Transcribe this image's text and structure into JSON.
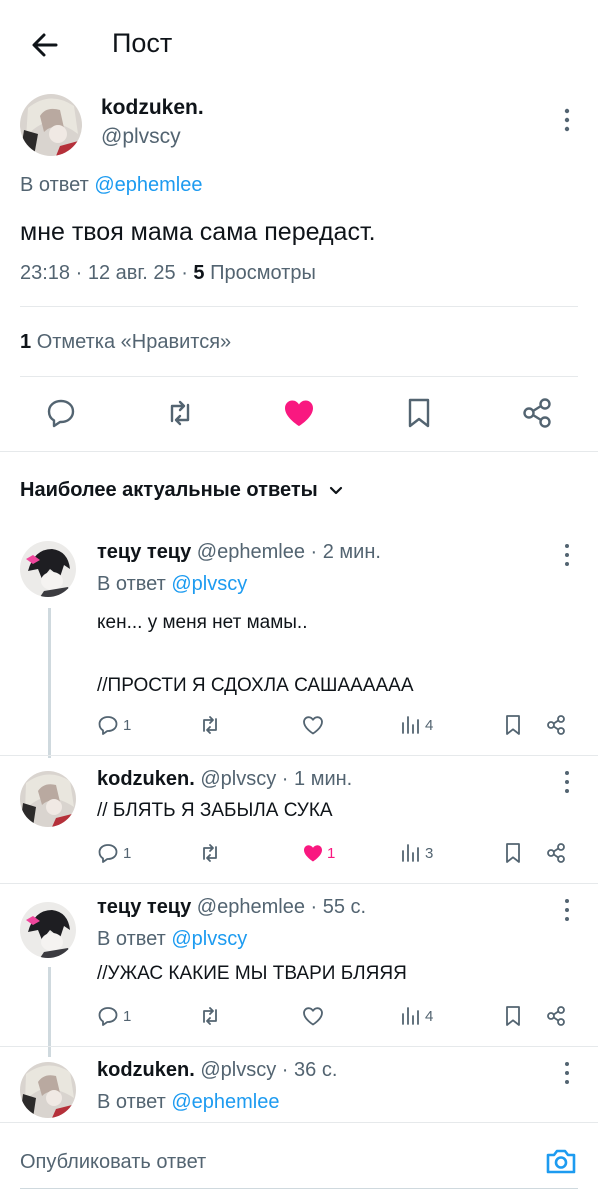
{
  "header": {
    "title": "Пост"
  },
  "main_post": {
    "display_name": "kodzuken.",
    "handle": "@plvscy",
    "reply_prefix": "В ответ",
    "reply_to": "@ephemlee",
    "text": "мне твоя мама сама передаст.",
    "time": "23:18",
    "date": "12 авг. 25",
    "sep": "·",
    "views_count": "5",
    "views_label": "Просмотры",
    "likes_count": "1",
    "likes_label": "Отметка «Нравится»"
  },
  "sort": {
    "label": "Наиболее актуальные ответы"
  },
  "replies": [
    {
      "display_name": "тецу тецу",
      "handle": "@ephemlee",
      "time": "· 2 мин.",
      "reply_prefix": "В ответ",
      "reply_to": "@plvscy",
      "text_line1": "кен... у меня нет мамы..",
      "text_line2": "//ПРОСТИ Я СДОХЛА САШААААAA",
      "replies": "1",
      "likes": "",
      "views": "4",
      "liked": false
    },
    {
      "display_name": "kodzuken.",
      "handle": "@plvscy",
      "time": "· 1 мин.",
      "text_line1": "// БЛЯТЬ Я ЗАБЫЛА СУКА",
      "replies": "1",
      "likes": "1",
      "views": "3",
      "liked": true
    },
    {
      "display_name": "тецу тецу",
      "handle": "@ephemlee",
      "time": "· 55 с.",
      "reply_prefix": "В ответ",
      "reply_to": "@plvscy",
      "text_line1": "//УЖАС КАКИЕ МЫ ТВАРИ БЛЯЯЯ",
      "replies": "1",
      "likes": "",
      "views": "4",
      "liked": false
    },
    {
      "display_name": "kodzuken.",
      "handle": "@plvscy",
      "time": "· 36 с.",
      "reply_prefix": "В ответ",
      "reply_to": "@ephemlee"
    }
  ],
  "composer": {
    "placeholder": "Опубликовать ответ"
  },
  "colors": {
    "accent": "#1d9bf0",
    "like": "#f91880",
    "muted": "#536471"
  }
}
